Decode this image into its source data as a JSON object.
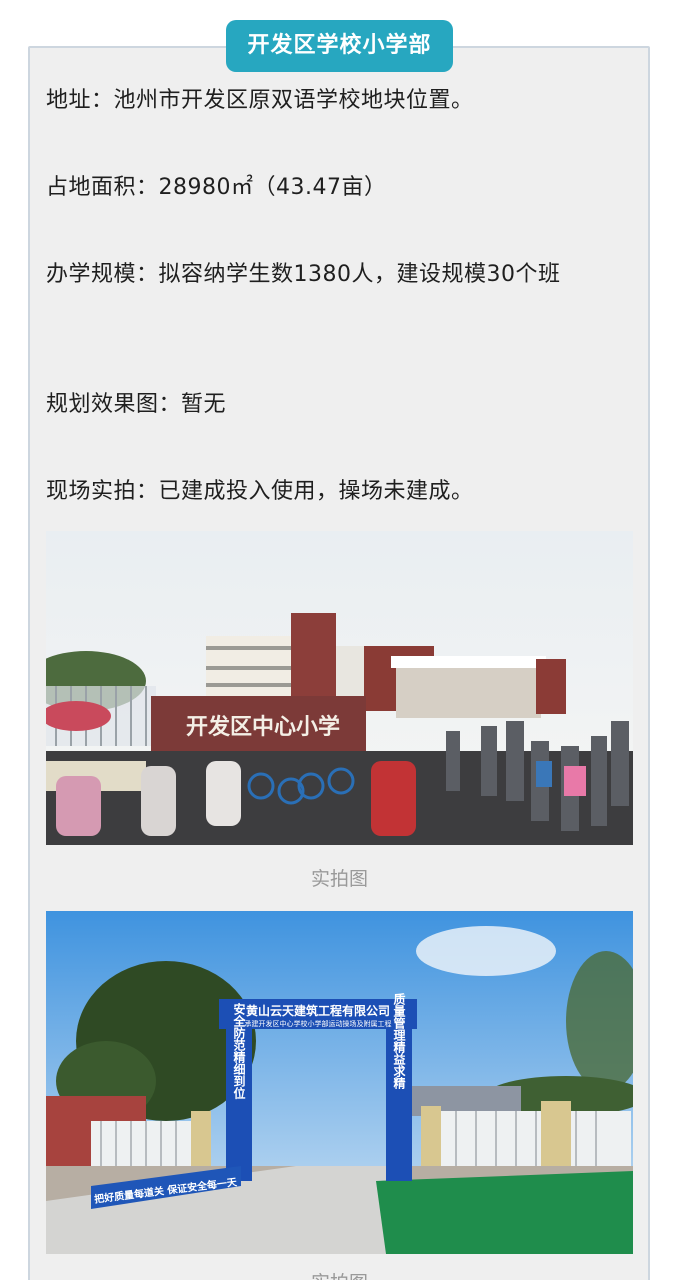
{
  "header": {
    "badge_title": "开发区学校小学部"
  },
  "details": {
    "address": "地址：池州市开发区原双语学校地块位置。",
    "area": "占地面积：28980㎡（43.47亩）",
    "scale": "办学规模：拟容纳学生数1380人，建设规模30个班",
    "rendering": "规划效果图：暂无",
    "site_photo": "现场实拍：已建成投入使用，操场未建成。"
  },
  "photos": [
    {
      "caption": "实拍图",
      "sign_text": "开发区中心小学",
      "icon": "school-gate-photo"
    },
    {
      "caption": "实拍图",
      "arch_title": "黄山云天建筑工程有限公司",
      "arch_subtitle": "承建开发区中心学校小学部运动操场及附属工程",
      "left_pillar": "安全防范精细到位",
      "right_pillar": "质量管理精益求精",
      "banner": "把好质量每道关 保证安全每一天",
      "icon": "construction-arch-photo"
    }
  ],
  "colors": {
    "badge": "#27a7c0",
    "card_background": "#efefef",
    "card_border": "#cdd6df",
    "caption": "#9a9a9a",
    "arch_blue": "#1c4fb5"
  }
}
